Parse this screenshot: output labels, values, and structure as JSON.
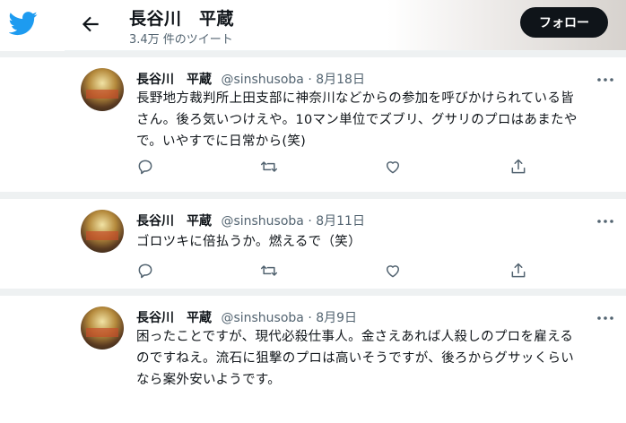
{
  "colors": {
    "text": "#0f1419",
    "muted": "#536471",
    "brand": "#1d9bf0",
    "follow_bg": "#0f1419"
  },
  "header": {
    "name": "長谷川　平蔵",
    "tweet_count": "3.4万 件のツイート",
    "follow_label": "フォロー"
  },
  "tweets": [
    {
      "name": "長谷川　平蔵",
      "handle": "@sinshusoba",
      "dot": "·",
      "date": "8月18日",
      "lines": [
        "長野地方裁判所上田支部に神奈川などからの参加を呼びかけられている皆",
        "さん。後ろ気いつけえや。10マン単位でズブリ、グサリのプロはあまたや",
        "で。いやすでに日常から(笑)"
      ]
    },
    {
      "name": "長谷川　平蔵",
      "handle": "@sinshusoba",
      "dot": "·",
      "date": "8月11日",
      "lines": [
        "ゴロツキに倍払うか。燃えるで（笑）"
      ]
    },
    {
      "name": "長谷川　平蔵",
      "handle": "@sinshusoba",
      "dot": "·",
      "date": "8月9日",
      "lines": [
        "困ったことですが、現代必殺仕事人。金さえあれば人殺しのプロを雇える",
        "のですねえ。流石に狙撃のプロは高いそうですが、後ろからグサッくらい",
        "なら案外安いようです。"
      ]
    }
  ]
}
